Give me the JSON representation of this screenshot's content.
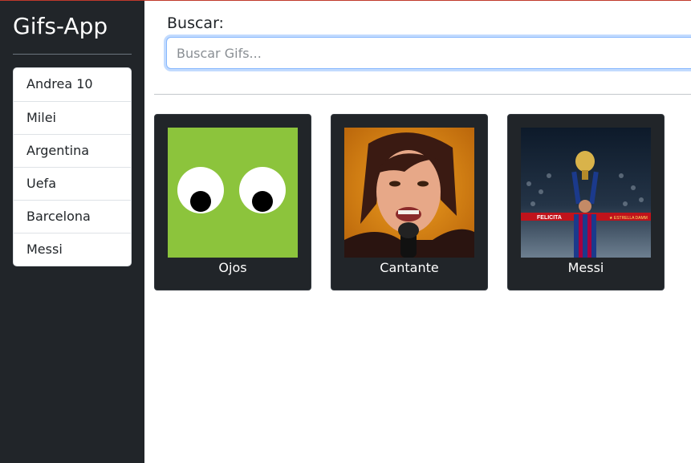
{
  "app": {
    "title": "Gifs-App"
  },
  "history": [
    "Andrea 10",
    "Milei",
    "Argentina",
    "Uefa",
    "Barcelona",
    "Messi"
  ],
  "search": {
    "label": "Buscar:",
    "placeholder": "Buscar Gifs...",
    "value": ""
  },
  "gifs": [
    {
      "title": "Ojos",
      "icon": "eyes-image"
    },
    {
      "title": "Cantante",
      "icon": "singer-image"
    },
    {
      "title": "Messi",
      "icon": "messi-image"
    }
  ],
  "colors": {
    "sidebar": "#212529",
    "card": "#212529",
    "accent": "#86b7fe"
  }
}
